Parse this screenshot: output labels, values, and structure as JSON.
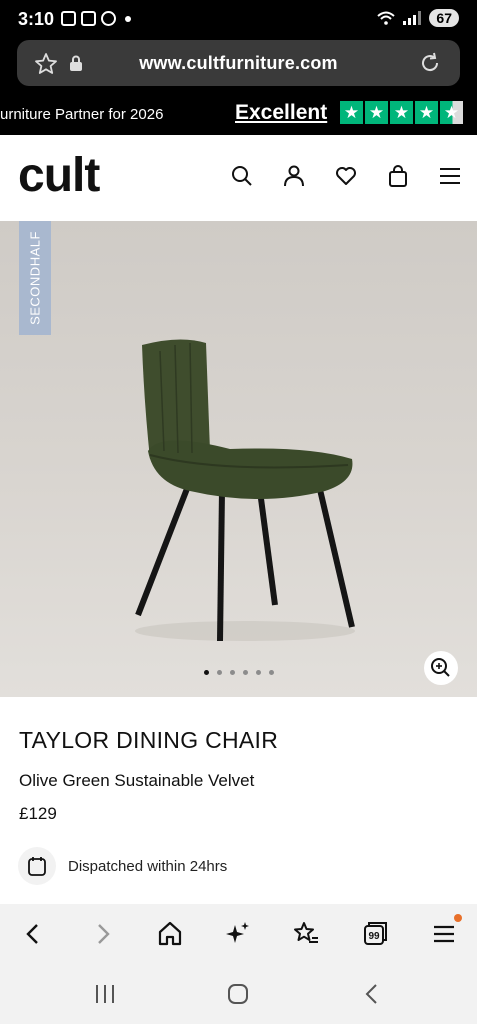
{
  "status_bar": {
    "time": "3:10",
    "battery": "67"
  },
  "browser": {
    "url": "www.cultfurniture.com"
  },
  "promo": {
    "partner_text": "urniture Partner for 2026",
    "rating_label": "Excellent",
    "stars": 4.5
  },
  "header": {
    "logo": "cult"
  },
  "hero": {
    "badge": "SECONDHALF",
    "image_count": 6,
    "active_image": 1
  },
  "product": {
    "title": "TAYLOR DINING CHAIR",
    "variant": "Olive Green Sustainable Velvet",
    "price": "£129",
    "dispatch": "Dispatched within 24hrs"
  },
  "browser_toolbar": {
    "tabs_count": "99"
  },
  "colors": {
    "trustpilot_green": "#00b67a",
    "badge_blue": "#a9b8cf",
    "chair_green": "#3b4a2a"
  }
}
